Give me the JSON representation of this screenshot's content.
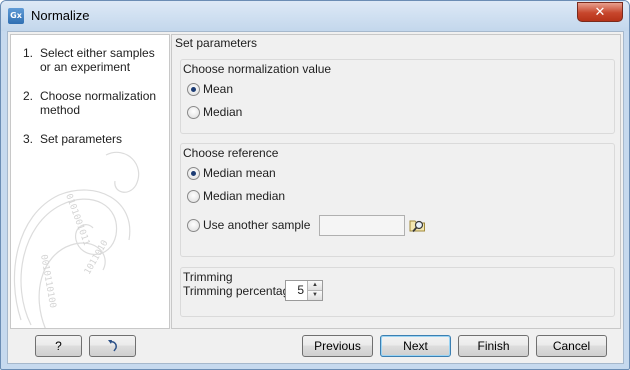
{
  "window": {
    "title": "Normalize",
    "app_icon_text": "Gx",
    "close_symbol": "✕"
  },
  "steps": [
    {
      "number": "1.",
      "text": "Select either samples or an experiment"
    },
    {
      "number": "2.",
      "text": "Choose normalization method"
    },
    {
      "number": "3.",
      "text": "Set parameters"
    }
  ],
  "panel": {
    "title": "Set parameters",
    "normalization": {
      "title": "Choose normalization value",
      "options": [
        {
          "label": "Mean",
          "checked": true
        },
        {
          "label": "Median",
          "checked": false
        }
      ]
    },
    "reference": {
      "title": "Choose reference",
      "options": [
        {
          "label": "Median mean",
          "checked": true
        },
        {
          "label": "Median median",
          "checked": false
        },
        {
          "label": "Use another sample",
          "checked": false
        }
      ],
      "sample_value": ""
    },
    "trimming": {
      "title": "Trimming",
      "label": "Trimming percentage",
      "value": "5"
    }
  },
  "buttons": {
    "help": "?",
    "reset": "↶",
    "previous": "Previous",
    "next": "Next",
    "finish": "Finish",
    "cancel": "Cancel"
  },
  "icons": {
    "app": "gx-app-icon",
    "browse": "browse-folder-icon",
    "reset": "reset-arrow-icon"
  }
}
